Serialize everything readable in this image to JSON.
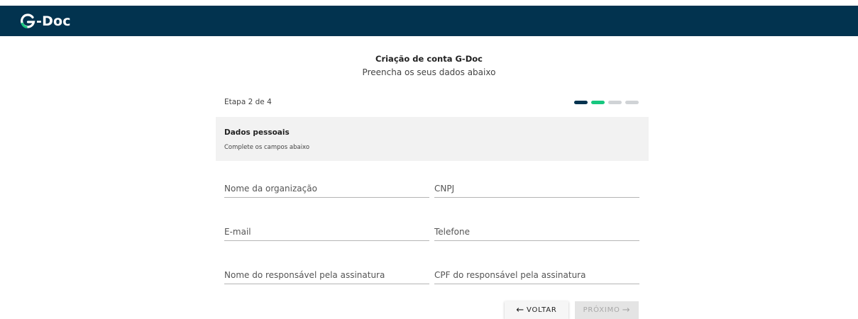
{
  "app": {
    "logo_text": "-Doc"
  },
  "header": {
    "title": "Criação de conta G-Doc",
    "subtitle": "Preencha os seus dados abaixo"
  },
  "progress": {
    "label": "Etapa 2 de 4",
    "current": 2,
    "total": 4,
    "colors": {
      "done": "#02334f",
      "active": "#17c77f",
      "pending": "#d0d3d6"
    }
  },
  "section": {
    "title": "Dados pessoais",
    "subtitle": "Complete os campos abaixo"
  },
  "form": {
    "org_name": {
      "placeholder": "Nome da organização",
      "value": ""
    },
    "cnpj": {
      "placeholder": "CNPJ",
      "value": ""
    },
    "email": {
      "placeholder": "E-mail",
      "value": ""
    },
    "phone": {
      "placeholder": "Telefone",
      "value": ""
    },
    "signer_name": {
      "placeholder": "Nome do responsável pela assinatura",
      "value": ""
    },
    "signer_cpf": {
      "placeholder": "CPF do responsável pela assinatura",
      "value": ""
    }
  },
  "actions": {
    "back_label": "VOLTAR",
    "next_label": "PRÓXIMO",
    "back_icon": "arrow-left-icon",
    "next_icon": "arrow-right-icon"
  },
  "colors": {
    "brand_navy": "#02334f",
    "brand_green": "#17c77f"
  }
}
